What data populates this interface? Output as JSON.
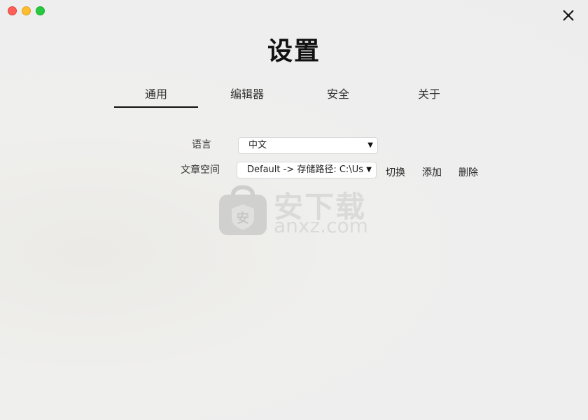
{
  "window": {
    "title": "设置",
    "traffic_lights": [
      "close",
      "minimize",
      "zoom"
    ],
    "close_icon": "close-icon"
  },
  "tabs": [
    {
      "label": "通用",
      "active": true
    },
    {
      "label": "编辑器",
      "active": false
    },
    {
      "label": "安全",
      "active": false
    },
    {
      "label": "关于",
      "active": false
    }
  ],
  "general": {
    "language": {
      "label": "语言",
      "value": "中文"
    },
    "workspace": {
      "label": "文章空间",
      "value": "Default -> 存储路径: C:\\Us",
      "switch_label": "切换",
      "add_label": "添加",
      "delete_label": "删除"
    }
  },
  "watermark": {
    "cn": "安下载",
    "en": "anxz.com",
    "badge": "安"
  },
  "colors": {
    "traffic_red": "#fe5f57",
    "traffic_yellow": "#febc2e",
    "traffic_green": "#28c840",
    "active_tab_underline": "#111111"
  }
}
